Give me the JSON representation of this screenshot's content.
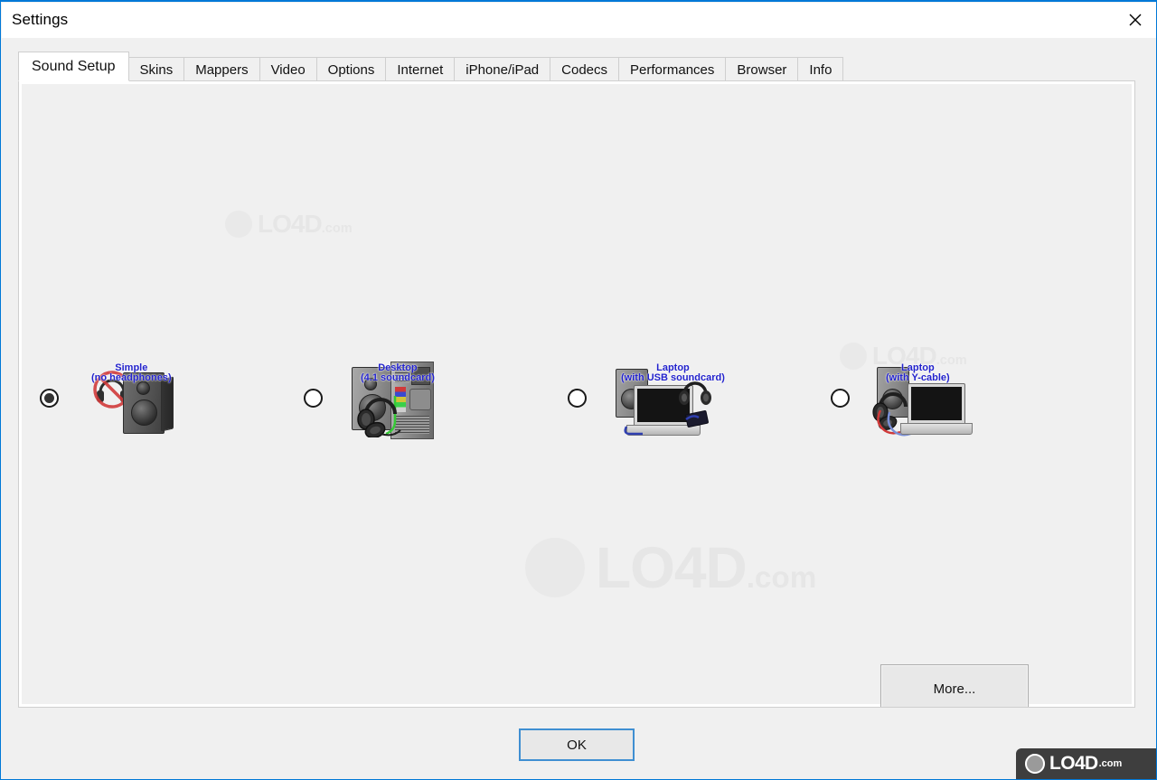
{
  "window": {
    "title": "Settings",
    "close_icon": "close-icon",
    "accent_color": "#0078d7"
  },
  "tabs": [
    {
      "label": "Sound Setup",
      "selected": true
    },
    {
      "label": "Skins",
      "selected": false
    },
    {
      "label": "Mappers",
      "selected": false
    },
    {
      "label": "Video",
      "selected": false
    },
    {
      "label": "Options",
      "selected": false
    },
    {
      "label": "Internet",
      "selected": false
    },
    {
      "label": "iPhone/iPad",
      "selected": false
    },
    {
      "label": "Codecs",
      "selected": false
    },
    {
      "label": "Performances",
      "selected": false
    },
    {
      "label": "Browser",
      "selected": false
    },
    {
      "label": "Info",
      "selected": false
    }
  ],
  "sound_setup": {
    "label_color": "#2222cc",
    "options": [
      {
        "title": "Simple",
        "subtitle": "(no headphones)",
        "selected": true,
        "graphic": "speaker-no-headphones-image"
      },
      {
        "title": "Desktop",
        "subtitle": "(4.1 soundcard)",
        "selected": false,
        "graphic": "desktop-tower-headphones-image"
      },
      {
        "title": "Laptop",
        "subtitle": "(with USB soundcard)",
        "selected": false,
        "graphic": "laptop-usb-soundcard-image"
      },
      {
        "title": "Laptop",
        "subtitle": "(with Y-cable)",
        "selected": false,
        "graphic": "laptop-y-cable-image"
      }
    ],
    "more_label": "More..."
  },
  "footer": {
    "ok_label": "OK"
  },
  "watermarks": {
    "text": "LO4D",
    "suffix": ".com"
  }
}
